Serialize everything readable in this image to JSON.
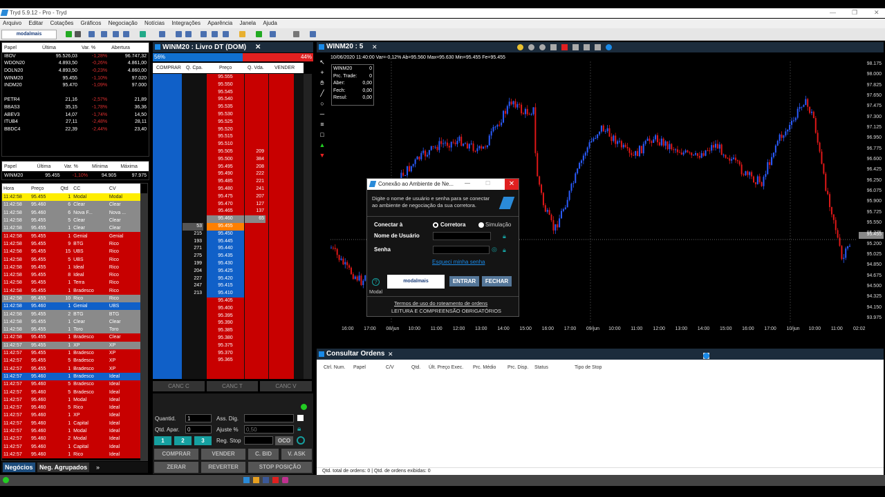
{
  "window": {
    "title": "Tryd 5.9.12 - Pro - Tryd"
  },
  "menu": [
    "Arquivo",
    "Editar",
    "Cotações",
    "Gráficos",
    "Negociação",
    "Notícias",
    "Integrações",
    "Aparência",
    "Janela",
    "Ajuda"
  ],
  "toolbar": {
    "brand": "modalmais"
  },
  "quotes": {
    "headers": [
      "Papel",
      "Última",
      "Var. %",
      "Abertura"
    ],
    "rows": [
      [
        "IBOV",
        "95.526,03",
        "-1,28%",
        "96.747,32"
      ],
      [
        "WDON20",
        "4.893,50",
        "-0,26%",
        "4.861,00"
      ],
      [
        "DOLN20",
        "4.893,50",
        "-0,23%",
        "4.860,00"
      ],
      [
        "WINM20",
        "95.455",
        "-1,10%",
        "97.020"
      ],
      [
        "INDM20",
        "95.470",
        "-1,09%",
        "97.000"
      ],
      [
        "",
        "",
        "",
        ""
      ],
      [
        "PETR4",
        "21,16",
        "-2,57%",
        "21,89"
      ],
      [
        "BBAS3",
        "35,15",
        "-1,78%",
        "36,36"
      ],
      [
        "ABEV3",
        "14,07",
        "-1,74%",
        "14,50"
      ],
      [
        "ITUB4",
        "27,11",
        "-2,48%",
        "28,11"
      ],
      [
        "BBDC4",
        "22,39",
        "-2,44%",
        "23,40"
      ]
    ]
  },
  "quote2": {
    "headers": [
      "Papel",
      "Última",
      "Var. %",
      "Mínima",
      "Máxima"
    ],
    "row": [
      "WINM20",
      "95.455",
      "-1,10%",
      "94.905",
      "97.975"
    ]
  },
  "trades": {
    "headers": [
      "Hora",
      "Preço",
      "Qtd",
      "CC",
      "CV"
    ],
    "rows": [
      [
        "11:42:58",
        "95.455",
        "1",
        "Modal",
        "Modal",
        "yel"
      ],
      [
        "11:42:58",
        "95.460",
        "6",
        "Clear",
        "Clear",
        "gray"
      ],
      [
        "11:42:58",
        "95.460",
        "6",
        "Nova F...",
        "Nova ...",
        "gray"
      ],
      [
        "11:42:58",
        "95.455",
        "5",
        "Clear",
        "Clear",
        "gray"
      ],
      [
        "11:42:58",
        "95.455",
        "1",
        "Clear",
        "Clear",
        "gray"
      ],
      [
        "11:42:58",
        "95.455",
        "1",
        "Genial",
        "Genial",
        "red"
      ],
      [
        "11:42:58",
        "95.455",
        "9",
        "BTG",
        "Rico",
        "red"
      ],
      [
        "11:42:58",
        "95.455",
        "15",
        "UBS",
        "Rico",
        "red"
      ],
      [
        "11:42:58",
        "95.455",
        "5",
        "UBS",
        "Rico",
        "red"
      ],
      [
        "11:42:58",
        "95.455",
        "1",
        "Ideal",
        "Rico",
        "red"
      ],
      [
        "11:42:58",
        "95.455",
        "8",
        "Ideal",
        "Rico",
        "red"
      ],
      [
        "11:42:58",
        "95.455",
        "1",
        "Terra",
        "Rico",
        "red"
      ],
      [
        "11:42:58",
        "95.455",
        "1",
        "Bradesco",
        "Rico",
        "red"
      ],
      [
        "11:42:58",
        "95.455",
        "10",
        "Rico",
        "Rico",
        "gray"
      ],
      [
        "11:42:58",
        "95.460",
        "1",
        "Genial",
        "UBS",
        "blue"
      ],
      [
        "11:42:58",
        "95.455",
        "2",
        "BTG",
        "BTG",
        "gray"
      ],
      [
        "11:42:58",
        "95.455",
        "1",
        "Clear",
        "Clear",
        "gray"
      ],
      [
        "11:42:58",
        "95.455",
        "1",
        "Toro",
        "Toro",
        "gray"
      ],
      [
        "11:42:58",
        "95.455",
        "1",
        "Bradesco",
        "Clear",
        "red"
      ],
      [
        "11:42:57",
        "95.455",
        "1",
        "XP",
        "XP",
        "gray"
      ],
      [
        "11:42:57",
        "95.455",
        "1",
        "Bradesco",
        "XP",
        "red"
      ],
      [
        "11:42:57",
        "95.455",
        "5",
        "Bradesco",
        "XP",
        "red"
      ],
      [
        "11:42:57",
        "95.455",
        "1",
        "Bradesco",
        "XP",
        "red"
      ],
      [
        "11:42:57",
        "95.460",
        "1",
        "Bradesco",
        "Ideal",
        "blue"
      ],
      [
        "11:42:57",
        "95.460",
        "5",
        "Bradesco",
        "Ideal",
        "red"
      ],
      [
        "11:42:57",
        "95.460",
        "5",
        "Bradesco",
        "Ideal",
        "red"
      ],
      [
        "11:42:57",
        "95.460",
        "1",
        "Modal",
        "Ideal",
        "red"
      ],
      [
        "11:42:57",
        "95.460",
        "5",
        "Rico",
        "Ideal",
        "red"
      ],
      [
        "11:42:57",
        "95.460",
        "1",
        "XP",
        "Ideal",
        "red"
      ],
      [
        "11:42:57",
        "95.460",
        "1",
        "Capital",
        "Ideal",
        "red"
      ],
      [
        "11:42:57",
        "95.460",
        "1",
        "Modal",
        "Ideal",
        "red"
      ],
      [
        "11:42:57",
        "95.460",
        "2",
        "Modal",
        "Ideal",
        "red"
      ],
      [
        "11:42:57",
        "95.460",
        "1",
        "Capital",
        "Ideal",
        "red"
      ],
      [
        "11:42:57",
        "95.460",
        "1",
        "Rico",
        "Ideal",
        "red"
      ]
    ]
  },
  "bottom_tabs": [
    "Negócios",
    "Neg. Agrupados"
  ],
  "dom": {
    "title": "WINM20 : Livro DT (DOM)",
    "buy_pct": "56%",
    "sell_pct": "44%",
    "buy_fraction": 0.56,
    "columns": [
      "COMPRAR",
      "Q. Cpa.",
      "Preço",
      "Q. Vda.",
      "VENDER"
    ],
    "prices": [
      "95.555",
      "95.550",
      "95.545",
      "95.540",
      "95.535",
      "95.530",
      "95.525",
      "95.520",
      "95.515",
      "95.510",
      "95.505",
      "95.500",
      "95.495",
      "95.490",
      "95.485",
      "95.480",
      "95.475",
      "95.470",
      "95.465",
      "95.460",
      "95.455",
      "95.450",
      "95.445",
      "95.440",
      "95.435",
      "95.430",
      "95.425",
      "95.420",
      "95.415",
      "95.410",
      "95.405",
      "95.400",
      "95.395",
      "95.390",
      "95.385",
      "95.380",
      "95.375",
      "95.370",
      "95.365"
    ],
    "sell_qty": [
      "",
      "",
      "",
      "",
      "",
      "",
      "",
      "",
      "",
      "",
      "209",
      "384",
      "208",
      "222",
      "221",
      "241",
      "207",
      "127",
      "137",
      "65",
      "",
      "",
      "",
      "",
      "",
      "",
      "",
      "",
      "",
      "",
      "",
      "",
      "",
      "",
      "",
      "",
      "",
      "",
      ""
    ],
    "buy_qty": [
      "",
      "",
      "",
      "",
      "",
      "",
      "",
      "",
      "",
      "",
      "",
      "",
      "",
      "",
      "",
      "",
      "",
      "",
      "",
      "",
      "53",
      "215",
      "193",
      "271",
      "275",
      "199",
      "204",
      "227",
      "247",
      "213",
      "",
      "",
      "",
      "",
      "",
      "",
      "",
      "",
      ""
    ]
  },
  "dom_cancel": [
    "CANC C",
    "CANC T",
    "CANC V"
  ],
  "order_form": {
    "quantid_label": "Quantid.",
    "quantid": "1",
    "ass_label": "Ass. Dig.",
    "qtd_apar_label": "Qtd. Apar.",
    "qtd_apar": "0",
    "ajuste_label": "Ajuste %",
    "ajuste": "0,50",
    "reg_stop_label": "Reg. Stop",
    "oco": "OCO",
    "nums": [
      "1",
      "2",
      "3"
    ],
    "buttons": [
      "COMPRAR",
      "VENDER",
      "C. BID",
      "V. ASK",
      "ZERAR",
      "REVERTER",
      "STOP POSIÇÃO"
    ]
  },
  "chart": {
    "title": "WINM20 : 5",
    "info": "10/06/2020 11:40:00  Var=-0,12%  Ab=95.560  Max=95.630  Min=95.455  Fe=95.455",
    "ohlc": [
      [
        "WINM20",
        "0"
      ],
      [
        "Prc. Trade:",
        "0"
      ],
      [
        "Aber:",
        "0,00"
      ],
      [
        "Fech:",
        "0,00"
      ],
      [
        "Resul:",
        "0,00"
      ]
    ],
    "y_ticks": [
      "98.175",
      "98.000",
      "97.825",
      "97.650",
      "97.475",
      "97.300",
      "97.125",
      "96.950",
      "96.775",
      "96.600",
      "96.425",
      "96.250",
      "96.075",
      "95.900",
      "95.725",
      "95.550",
      "95.375",
      "95.200",
      "95.025",
      "94.850",
      "94.675",
      "94.500",
      "94.325",
      "94.150",
      "93.975"
    ],
    "last_price": "95.455",
    "x_ticks": [
      "16:00",
      "17:00",
      "08/jun",
      "10:00",
      "11:00",
      "12:00",
      "13:00",
      "14:00",
      "15:00",
      "16:00",
      "17:00",
      "09/jun",
      "10:00",
      "11:00",
      "12:00",
      "13:00",
      "14:00",
      "15:00",
      "16:00",
      "17:00",
      "10/jun",
      "10:00",
      "11:00",
      "02:02"
    ],
    "colors": {
      "up": "#2a5cff",
      "down": "#e01818"
    }
  },
  "orders": {
    "title": "Consultar Ordens",
    "columns": [
      "Ctrl. Num.",
      "Papel",
      "C/V",
      "Qtd.",
      "Últ. Preço Exec.",
      "Prc. Médio",
      "Prc. Disp.",
      "Status",
      "Tipo de Stop"
    ],
    "footer": "Qtd. total de ordens: 0  |  Qtd. de ordens exibidas: 0"
  },
  "dialog": {
    "title": "Conexão ao Ambiente de Ne...",
    "text": "Digite o nome de usuário e senha para se conectar ao ambiente de negociação da sua corretora.",
    "connect_label": "Conectar à",
    "opt1": "Corretora",
    "opt2": "Simulação",
    "user_label": "Nome de Usuário",
    "pass_label": "Senha",
    "forgot": "Esqueci minha senha",
    "brand": "modalmais",
    "brand_caption": "Modal",
    "enter": "ENTRAR",
    "close": "FECHAR",
    "terms": "Termos de uso do roteamento de ordens",
    "terms2": "LEITURA E COMPREENSÃO OBRIGATÓRIOS"
  }
}
